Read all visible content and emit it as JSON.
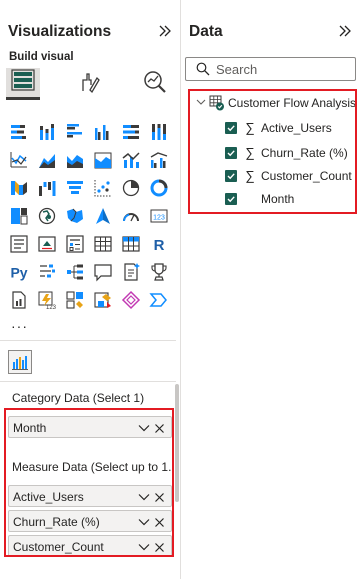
{
  "viz_pane": {
    "title": "Visualizations",
    "build_visual_label": "Build visual",
    "more": "···",
    "wells": [
      {
        "title": "Category Data (Select 1)",
        "fields": [
          "Month"
        ]
      },
      {
        "title": "Measure Data (Select up to 1...",
        "fields": [
          "Active_Users",
          "Churn_Rate (%)",
          "Customer_Count"
        ]
      }
    ]
  },
  "data_pane": {
    "title": "Data",
    "search_placeholder": "Search",
    "table": {
      "name": "Customer Flow Analysis",
      "fields": [
        {
          "name": "Active_Users",
          "checked": true,
          "sigma": true
        },
        {
          "name": "Churn_Rate (%)",
          "checked": true,
          "sigma": true
        },
        {
          "name": "Customer_Count",
          "checked": true,
          "sigma": true
        },
        {
          "name": "Month",
          "checked": true,
          "sigma": false
        }
      ]
    }
  },
  "colors": {
    "accent_check": "#1a5e52",
    "highlight_red": "#e31b23",
    "icon_blue": "#118dff",
    "icon_dark": "#3b3a39",
    "icon_yellow": "#e8a317"
  }
}
